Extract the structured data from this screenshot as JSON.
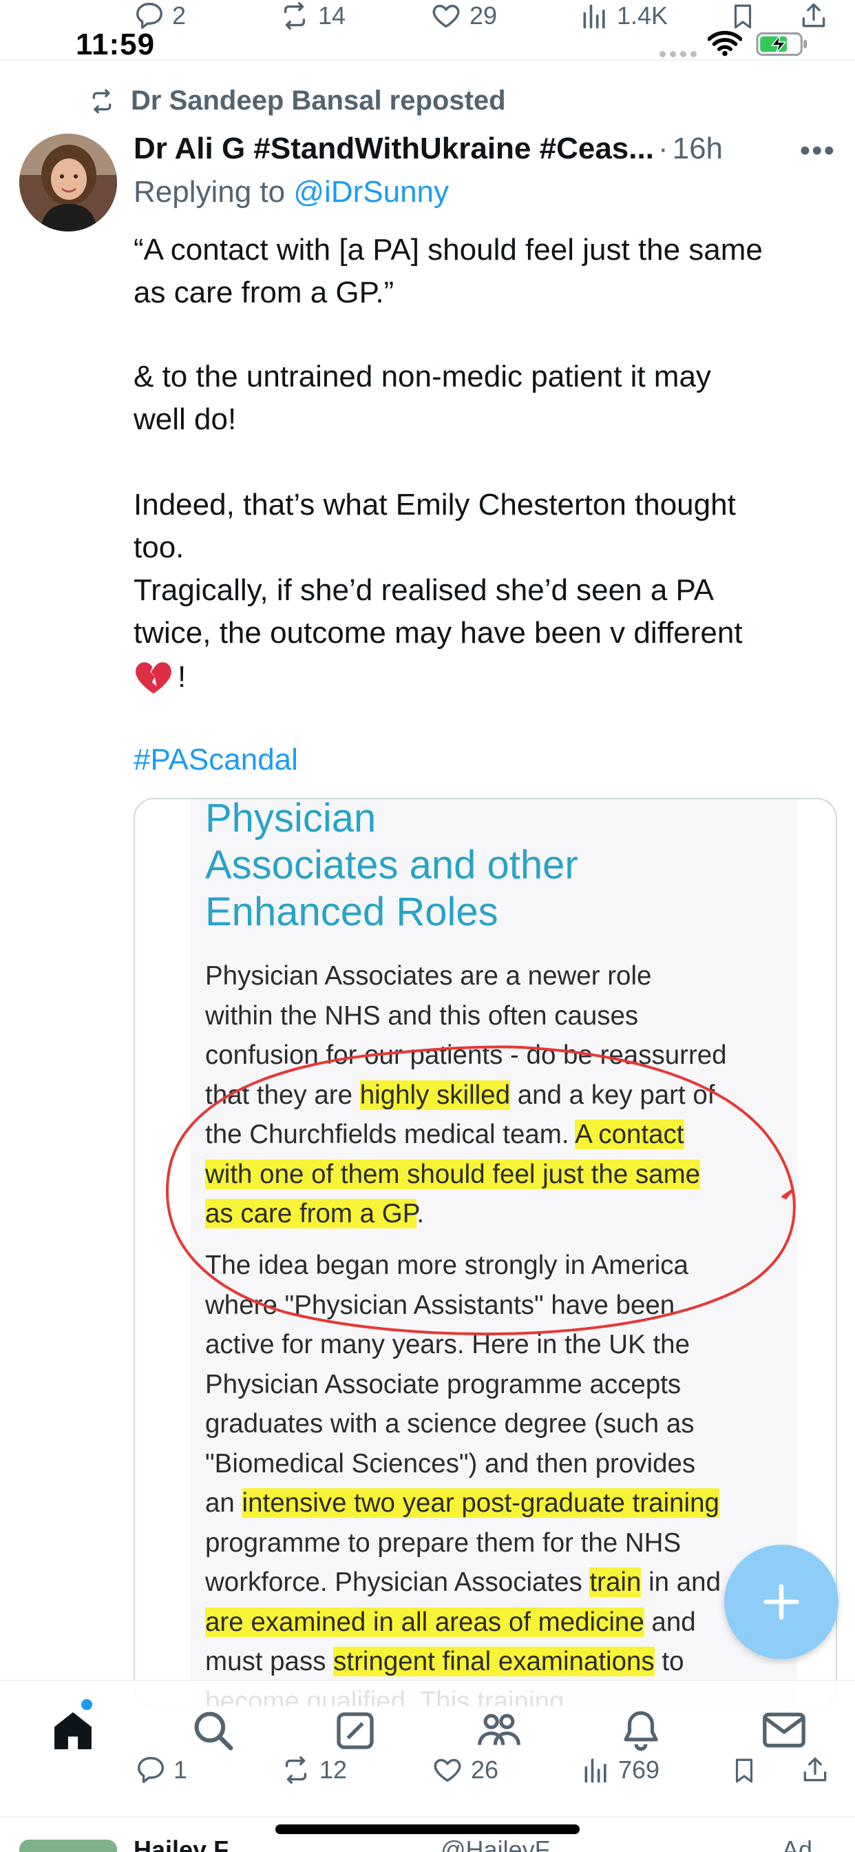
{
  "status_bar": {
    "time": "11:59"
  },
  "previous_tweet_actions": {
    "replies": "2",
    "reposts": "14",
    "likes": "29",
    "views": "1.4K"
  },
  "repost_header": {
    "label": "Dr Sandeep Bansal reposted"
  },
  "tweet": {
    "author_name": "Dr Ali G #StandWithUkraine #Ceas...",
    "separator": "·",
    "time": "16h",
    "reply_prefix": "Replying to",
    "reply_handle": "@iDrSunny",
    "lines": [
      "“A contact with [a PA] should feel just the same",
      "as care from a GP.”",
      "& to the untrained non-medic patient it may",
      "well do!",
      "Indeed, that’s what Emily Chesterton thought",
      "too.",
      "Tragically, if she’d realised she’d seen a PA",
      "twice, the outcome may have been v different",
      "!"
    ],
    "hashtag": "#PAScandal",
    "actions": {
      "replies": "1",
      "reposts": "12",
      "likes": "26",
      "views": "769"
    }
  },
  "media": {
    "title_lines": [
      "Physician",
      "Associates and other",
      "Enhanced Roles"
    ],
    "p1": [
      {
        "segs": [
          {
            "t": "Physician Associates are a newer role",
            "h": false
          }
        ]
      },
      {
        "segs": [
          {
            "t": "within the NHS and this often causes",
            "h": false
          }
        ]
      },
      {
        "segs": [
          {
            "t": "confusion for our patients - do be reassurred",
            "h": false
          }
        ]
      },
      {
        "segs": [
          {
            "t": "that they are ",
            "h": false
          },
          {
            "t": "highly skilled",
            "h": true
          },
          {
            "t": " and a key part of",
            "h": false
          }
        ]
      },
      {
        "segs": [
          {
            "t": "the Churchfields medical team. ",
            "h": false
          },
          {
            "t": "A contact",
            "h": true
          }
        ]
      },
      {
        "segs": [
          {
            "t": "with one of them should feel just the same",
            "h": true
          }
        ]
      },
      {
        "segs": [
          {
            "t": "as care from a GP",
            "h": true
          },
          {
            "t": ".",
            "h": false
          }
        ]
      }
    ],
    "p2": [
      {
        "segs": [
          {
            "t": "The idea began more strongly in America",
            "h": false
          }
        ]
      },
      {
        "segs": [
          {
            "t": "where \"Physician Assistants\" have been",
            "h": false
          }
        ]
      },
      {
        "segs": [
          {
            "t": "active for many years. Here in the UK the",
            "h": false
          }
        ]
      },
      {
        "segs": [
          {
            "t": "Physician Associate programme accepts",
            "h": false
          }
        ]
      },
      {
        "segs": [
          {
            "t": "graduates with a science degree (such as",
            "h": false
          }
        ]
      },
      {
        "segs": [
          {
            "t": "\"Biomedical Sciences\") and then provides",
            "h": false
          }
        ]
      },
      {
        "segs": [
          {
            "t": "an ",
            "h": false
          },
          {
            "t": "intensive two year post-graduate training",
            "h": true
          }
        ]
      },
      {
        "segs": [
          {
            "t": "programme to prepare them for the NHS",
            "h": false
          }
        ]
      },
      {
        "segs": [
          {
            "t": "workforce. Physician Associates ",
            "h": false
          },
          {
            "t": "train",
            "h": true
          },
          {
            "t": " in and",
            "h": false
          }
        ]
      },
      {
        "segs": [
          {
            "t": "are examined in all areas of medicine",
            "h": true
          },
          {
            "t": " and",
            "h": false
          }
        ]
      },
      {
        "segs": [
          {
            "t": "must pass ",
            "h": false
          },
          {
            "t": "stringent final examinations",
            "h": true
          },
          {
            "t": " to",
            "h": false
          }
        ]
      },
      {
        "segs": [
          {
            "t": "become qualified. This training",
            "h": false
          }
        ]
      }
    ],
    "annotation_color": "#e53935",
    "highlight_color": "#f7f300"
  },
  "colors": {
    "link": "#1d9bf0",
    "muted": "#536471",
    "fab": "#8ecdf7",
    "title": "#27a3c7"
  },
  "nav": {
    "icons": [
      "home-icon",
      "search-icon",
      "grok-icon",
      "communities-icon",
      "notifications-icon",
      "messages-icon"
    ]
  },
  "next_tweet_peek": {
    "author": "Hailey F",
    "handle": "@HaileyF",
    "right": "Ad"
  }
}
